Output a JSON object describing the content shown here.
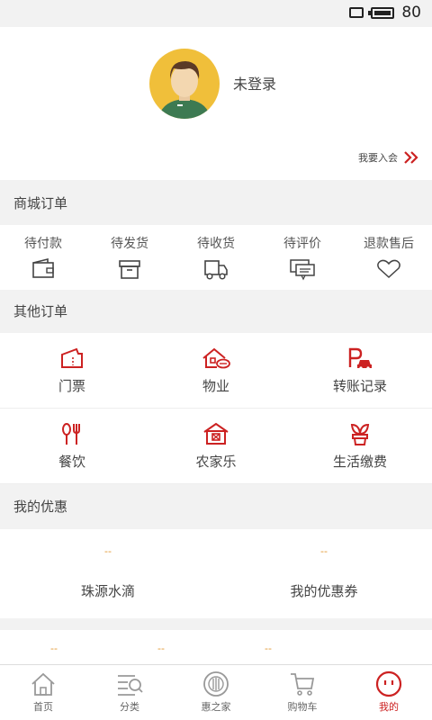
{
  "status": {
    "battery": "80"
  },
  "profile": {
    "login_status": "未登录",
    "join_link": "我要入会"
  },
  "mall_orders": {
    "title": "商城订单",
    "items": [
      {
        "label": "待付款",
        "icon": "wallet-icon"
      },
      {
        "label": "待发货",
        "icon": "box-icon"
      },
      {
        "label": "待收货",
        "icon": "truck-icon"
      },
      {
        "label": "待评价",
        "icon": "chat-icon"
      },
      {
        "label": "退款售后",
        "icon": "heart-icon"
      }
    ]
  },
  "other_orders": {
    "title": "其他订单",
    "items": [
      {
        "label": "门票",
        "icon": "ticket-icon"
      },
      {
        "label": "物业",
        "icon": "house-icon"
      },
      {
        "label": "转账记录",
        "icon": "parking-icon"
      },
      {
        "label": "餐饮",
        "icon": "dining-icon"
      },
      {
        "label": "农家乐",
        "icon": "farmhouse-icon"
      },
      {
        "label": "生活缴费",
        "icon": "plant-icon"
      }
    ]
  },
  "coupons": {
    "title": "我的优惠",
    "items": [
      {
        "value": "--",
        "label": "珠源水滴"
      },
      {
        "value": "--",
        "label": "我的优惠券"
      }
    ],
    "sub_values": [
      "--",
      "--",
      "--"
    ]
  },
  "tabbar": {
    "items": [
      {
        "label": "首页",
        "icon": "home-icon"
      },
      {
        "label": "分类",
        "icon": "category-icon"
      },
      {
        "label": "惠之家",
        "icon": "emblem-icon"
      },
      {
        "label": "购物车",
        "icon": "cart-icon"
      },
      {
        "label": "我的",
        "icon": "profile-icon"
      }
    ],
    "active": "我的"
  },
  "colors": {
    "accent": "#cc2222",
    "coupon_value": "#e0962b",
    "avatar_bg": "#f0bf3a"
  }
}
